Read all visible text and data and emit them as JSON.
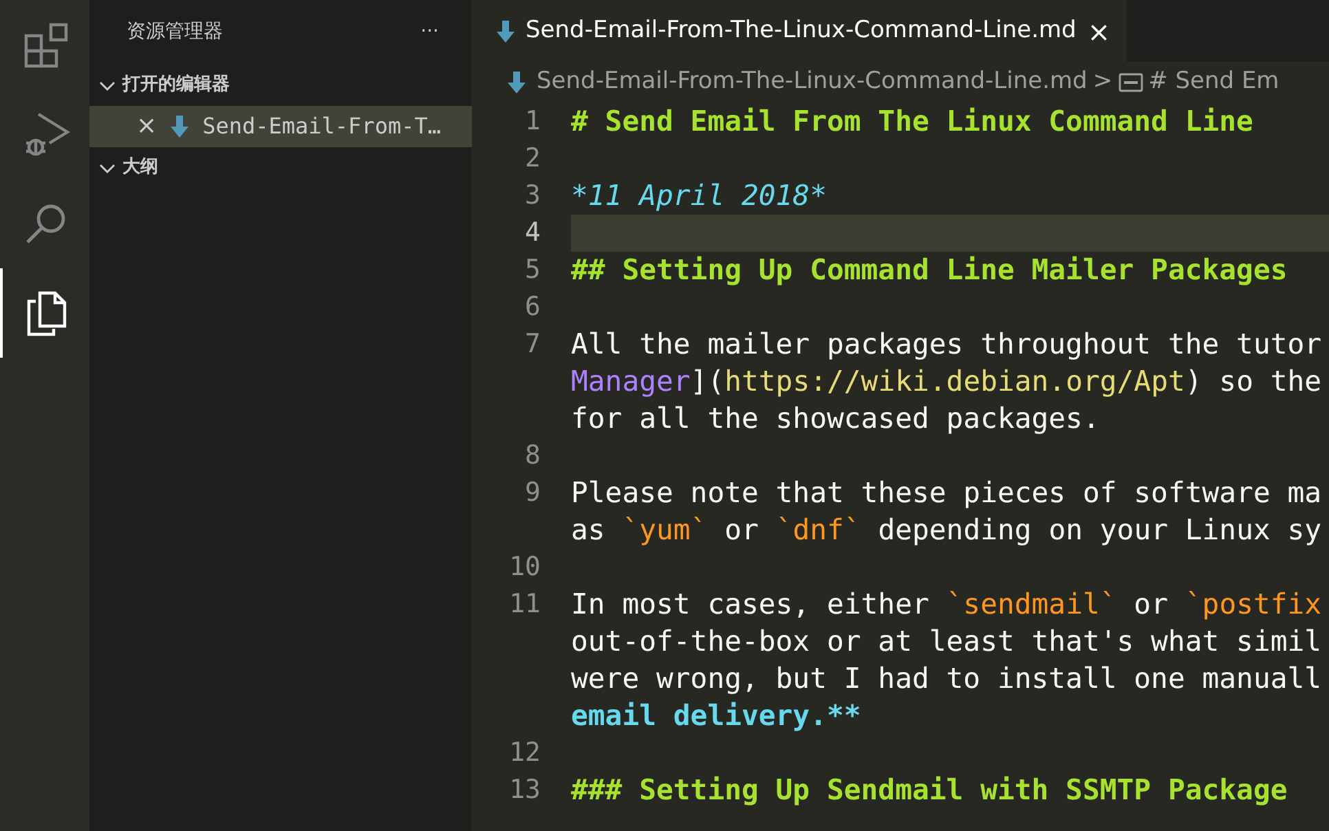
{
  "activity_bar": [
    {
      "kind": "extensions",
      "selected": false
    },
    {
      "kind": "debug",
      "selected": false
    },
    {
      "kind": "search",
      "selected": false
    },
    {
      "kind": "explorer",
      "selected": true
    }
  ],
  "sidebar": {
    "title": "资源管理器",
    "more": "···",
    "sections": [
      {
        "label": "打开的编辑器",
        "expanded": true,
        "items": [
          {
            "close": "×",
            "label": "Send-Email-From-T…",
            "selected": true
          }
        ]
      },
      {
        "label": "大纲",
        "expanded": true
      }
    ]
  },
  "tabs": [
    {
      "label": "Send-Email-From-The-Linux-Command-Line.md",
      "close": "×",
      "selected": true
    }
  ],
  "breadcrumbs": {
    "file": "Send-Email-From-The-Linux-Command-Line.md",
    "separator": ">",
    "symbol": "# Send Em"
  },
  "lines": [
    {
      "number": "1",
      "current": false,
      "rows": [
        [
          {
            "kind": "heading",
            "text": "# Send Email From The Linux Command Line"
          }
        ]
      ]
    },
    {
      "number": "2",
      "current": false,
      "rows": [
        []
      ]
    },
    {
      "number": "3",
      "current": false,
      "rows": [
        [
          {
            "kind": "italic",
            "text": "*11 April 2018*"
          }
        ]
      ]
    },
    {
      "number": "4",
      "current": true,
      "rows": [
        []
      ]
    },
    {
      "number": "5",
      "current": false,
      "rows": [
        [
          {
            "kind": "heading",
            "text": "## Setting Up Command Line Mailer Packages"
          }
        ]
      ]
    },
    {
      "number": "6",
      "current": false,
      "rows": [
        []
      ]
    },
    {
      "number": "7",
      "current": false,
      "rows": [
        [
          {
            "kind": "text",
            "text": "All the mailer packages throughout the tutor"
          }
        ],
        [
          {
            "kind": "link",
            "text": "Manager"
          },
          {
            "kind": "text",
            "text": "]("
          },
          {
            "kind": "url",
            "text": "https://wiki.debian.org/Apt"
          },
          {
            "kind": "text",
            "text": ") so the"
          }
        ],
        [
          {
            "kind": "text",
            "text": "for all the showcased packages."
          }
        ]
      ]
    },
    {
      "number": "8",
      "current": false,
      "rows": [
        []
      ]
    },
    {
      "number": "9",
      "current": false,
      "rows": [
        [
          {
            "kind": "text",
            "text": "Please note that these pieces of software ma"
          }
        ],
        [
          {
            "kind": "text",
            "text": "as "
          },
          {
            "kind": "code",
            "text": "`yum`"
          },
          {
            "kind": "text",
            "text": " or "
          },
          {
            "kind": "code",
            "text": "`dnf`"
          },
          {
            "kind": "text",
            "text": " depending on your Linux sy"
          }
        ]
      ]
    },
    {
      "number": "10",
      "current": false,
      "rows": [
        []
      ]
    },
    {
      "number": "11",
      "current": false,
      "rows": [
        [
          {
            "kind": "text",
            "text": "In most cases, either "
          },
          {
            "kind": "code",
            "text": "`sendmail`"
          },
          {
            "kind": "text",
            "text": " or "
          },
          {
            "kind": "code",
            "text": "`postfix"
          }
        ],
        [
          {
            "kind": "text",
            "text": "out-of-the-box or at least that's what simil"
          }
        ],
        [
          {
            "kind": "text",
            "text": "were wrong, but I had to install one manuall"
          }
        ],
        [
          {
            "kind": "bold",
            "text": "email delivery.**"
          }
        ]
      ]
    },
    {
      "number": "12",
      "current": false,
      "rows": [
        []
      ]
    },
    {
      "number": "13",
      "current": false,
      "rows": [
        [
          {
            "kind": "heading",
            "text": "### Setting Up Sendmail with SSMTP Package"
          }
        ]
      ]
    }
  ]
}
